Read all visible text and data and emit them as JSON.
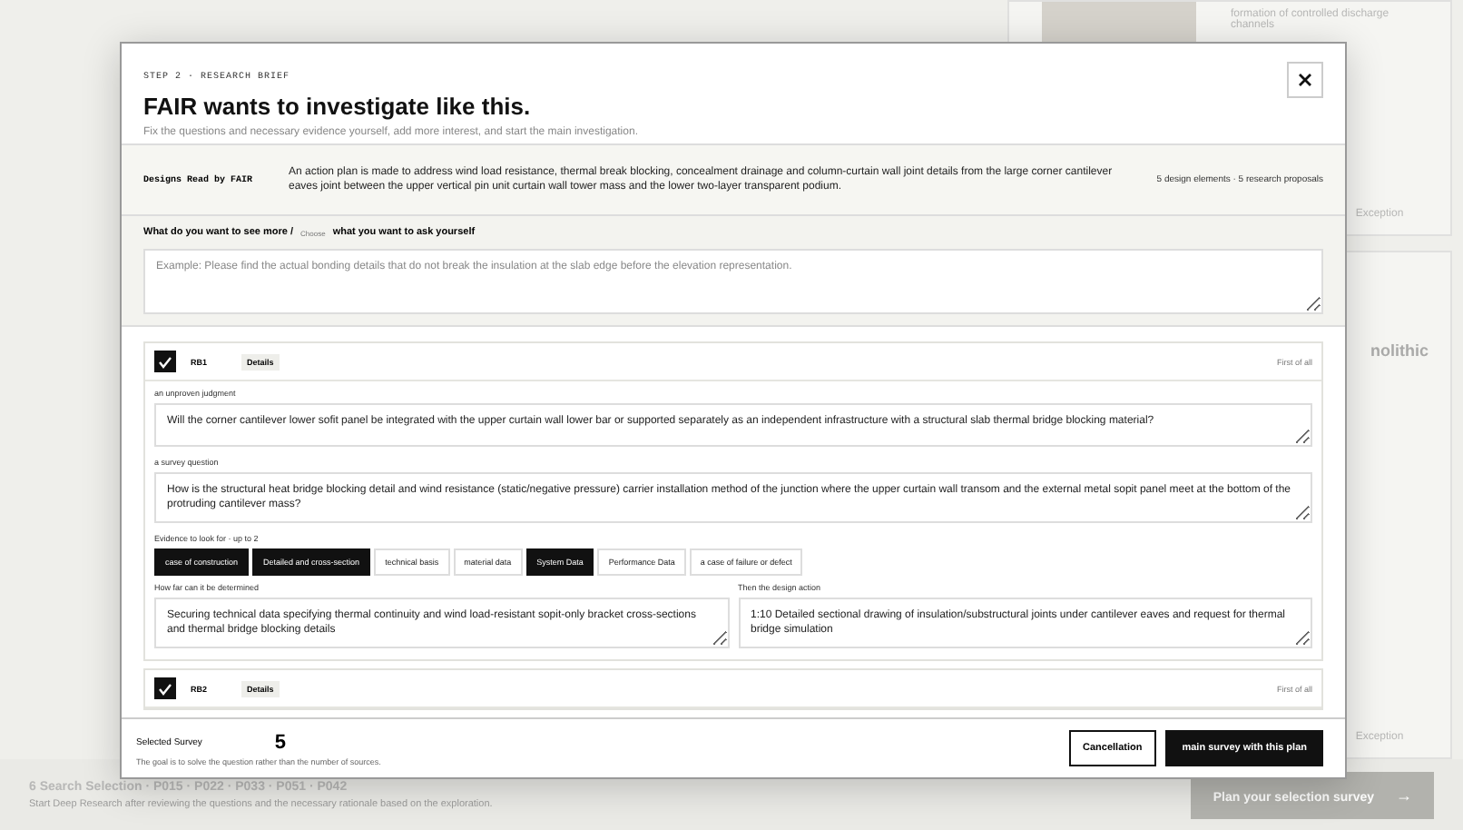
{
  "background": {
    "card_text": "formation of controlled discharge channels",
    "heading_fragment": "nolithic",
    "exception_buttons": [
      "Exception",
      "Exception"
    ],
    "bottom_bar": {
      "title": "6 Search Selection · P015 · P022 · P033 · P051 · P042",
      "subtitle": "Start Deep Research after reviewing the questions and the necessary rationale based on the exploration.",
      "button": "Plan your selection survey",
      "button_arrow": "→",
      "disabled": true
    }
  },
  "modal": {
    "step": "STEP 2 · RESEARCH BRIEF",
    "title": "FAIR wants to investigate like this.",
    "subtitle": "Fix the questions and necessary evidence yourself, add more interest, and start the main investigation.",
    "brief": {
      "label": "Designs Read by FAIR",
      "text": "An action plan is made to address wind load resistance, thermal break blocking, concealment drainage and column-curtain wall joint details from the large corner cantilever eaves joint between the upper vertical pin unit curtain wall tower mass and the lower two-layer transparent podium.",
      "meta": "5 design elements · 5 research proposals"
    },
    "ask": {
      "label": "What do you want to see more /",
      "hint": "Choose",
      "label_rest": "what you want to ask yourself",
      "placeholder": "Example: Please find the actual bonding details that do not break the insulation at the slab edge before the elevation representation."
    },
    "proposals": [
      {
        "id": "RB1",
        "checked": true,
        "details": "Details",
        "priority": "First of all",
        "judgment_label": "an unproven judgment",
        "judgment": "Will the corner cantilever lower sofit panel be integrated with the upper curtain wall lower bar or supported separately as an independent infrastructure with a structural slab thermal bridge blocking material?",
        "question_label": "a survey question",
        "question": "How is the structural heat bridge blocking detail and wind resistance (static/negative pressure) carrier installation method of the junction where the upper curtain wall transom and the external metal sopit panel meet at the bottom of the protruding cantilever mass?",
        "evidence_label": "Evidence to look for · up to 2",
        "evidence": [
          {
            "label": "case of construction",
            "selected": true
          },
          {
            "label": "Detailed and cross-section",
            "selected": true
          },
          {
            "label": "technical basis",
            "selected": false
          },
          {
            "label": "material data",
            "selected": false
          },
          {
            "label": "System Data",
            "selected": true
          },
          {
            "label": "Performance Data",
            "selected": false
          },
          {
            "label": "a case of failure or defect",
            "selected": false
          }
        ],
        "determine_label": "How far can it be determined",
        "determine": "Securing technical data specifying thermal continuity and wind load-resistant sopit-only bracket cross-sections and thermal bridge blocking details",
        "action_label": "Then the design action",
        "action": "1:10 Detailed sectional drawing of insulation/substructural joints under cantilever eaves and request for thermal bridge simulation"
      },
      {
        "id": "RB2",
        "checked": true,
        "details": "Details",
        "priority": "First of all"
      }
    ],
    "footer": {
      "label": "Selected Survey",
      "count": "5",
      "note": "The goal is to solve the question rather than the number of sources.",
      "cancel": "Cancellation",
      "confirm": "main survey with this plan"
    }
  }
}
